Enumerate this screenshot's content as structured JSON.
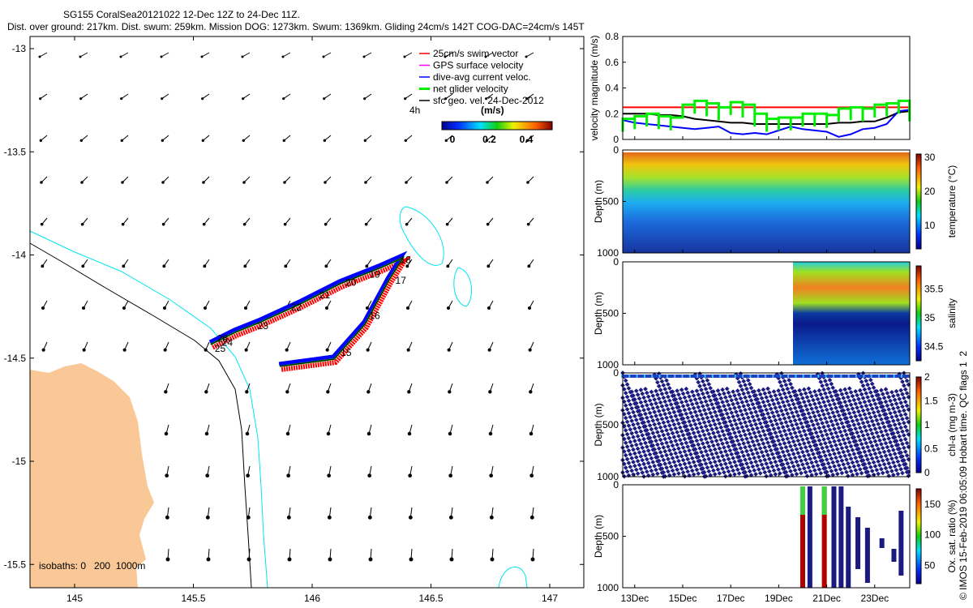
{
  "title": {
    "line1": "SG155 CoralSea20121022 12-Dec 12Z to 24-Dec 11Z.",
    "line2": "Dist. over ground: 217km. Dist. swum: 259km. Mission DOG: 1273km. Swum: 1369km. Gliding 24cm/s 142T COG-DAC=24cm/s 145T"
  },
  "colors": {
    "swim": "#ff0000",
    "gps": "#ff00ff",
    "dac": "#0000ff",
    "net": "#00ee00",
    "sfc": "#000000",
    "land": "#f9c896",
    "isobath200": "#000000",
    "isobath1000": "#00e5ee"
  },
  "chart_data": [
    {
      "type": "map",
      "xlim": [
        144.81,
        147.14
      ],
      "ylim": [
        -15.61,
        -12.94
      ],
      "xticks": [
        "145",
        "145.5",
        "146",
        "146.5",
        "147"
      ],
      "yticks": [
        "-13",
        "-13.5",
        "-14",
        "-14.5",
        "-15",
        "-15.5"
      ],
      "legend": {
        "placement": "top-right",
        "entries": [
          "25cm/s swim vector",
          "GPS surface velocity",
          "dive-avg current veloc.",
          "net glider velocity",
          "sfc geo. vel. 24-Dec-2012"
        ],
        "interval_label": "4h",
        "colorbar_label": "(m/s)",
        "colorbar_ticks": [
          "0",
          "0.2",
          "0.4"
        ]
      },
      "isobaths_label": "isobaths: 0   200  1000m",
      "track": [
        [
          145.864,
          -14.54
        ],
        [
          146.092,
          -14.505
        ],
        [
          146.222,
          -14.336
        ],
        [
          146.324,
          -14.12
        ],
        [
          146.382,
          -14.014
        ],
        [
          146.29,
          -14.061
        ],
        [
          146.119,
          -14.139
        ],
        [
          145.949,
          -14.238
        ],
        [
          145.778,
          -14.328
        ],
        [
          145.676,
          -14.375
        ],
        [
          145.573,
          -14.434
        ]
      ],
      "day_labels": [
        {
          "t": "15",
          "lon": 146.12,
          "lat": -14.49
        },
        {
          "t": "16",
          "lon": 146.24,
          "lat": -14.31
        },
        {
          "t": "17",
          "lon": 146.35,
          "lat": -14.14
        },
        {
          "t": "18",
          "lon": 146.37,
          "lat": -14.04
        },
        {
          "t": "19",
          "lon": 146.24,
          "lat": -14.11
        },
        {
          "t": "20",
          "lon": 146.14,
          "lat": -14.15
        },
        {
          "t": "21",
          "lon": 146.03,
          "lat": -14.21
        },
        {
          "t": "22",
          "lon": 145.91,
          "lat": -14.27
        },
        {
          "t": "23",
          "lon": 145.77,
          "lat": -14.36
        },
        {
          "t": "24",
          "lon": 145.62,
          "lat": -14.44
        },
        {
          "t": "25",
          "lon": 145.59,
          "lat": -14.47
        },
        {
          "t": "26",
          "lon": 145.6,
          "lat": -14.42
        }
      ]
    },
    {
      "type": "line",
      "ylabel": "velocity magnitude (m/s)",
      "ylim": [
        0,
        0.8
      ],
      "yticks": [
        "0",
        "0.2",
        "0.4",
        "0.6",
        "0.8"
      ],
      "x": [
        12.5,
        13,
        13.5,
        14,
        14.5,
        15,
        15.5,
        16,
        16.5,
        17,
        17.5,
        18,
        18.5,
        19,
        19.5,
        20,
        20.5,
        21,
        21.5,
        22,
        22.5,
        23,
        23.5,
        24,
        24.45
      ],
      "series": [
        {
          "color": "#ff0000",
          "values": [
            0.25,
            0.25,
            0.25,
            0.25,
            0.25,
            0.25,
            0.25,
            0.25,
            0.25,
            0.25,
            0.25,
            0.25,
            0.25,
            0.25,
            0.25,
            0.25,
            0.25,
            0.25,
            0.25,
            0.25,
            0.25,
            0.25,
            0.25,
            0.25,
            0.25
          ]
        },
        {
          "color": "#000000",
          "values": [
            0.2,
            0.2,
            0.2,
            0.19,
            0.19,
            0.18,
            0.16,
            0.15,
            0.14,
            0.13,
            0.13,
            0.12,
            0.12,
            0.12,
            0.12,
            0.12,
            0.12,
            0.12,
            0.13,
            0.13,
            0.14,
            0.14,
            0.17,
            0.21,
            0.22
          ]
        },
        {
          "color": "#0000ff",
          "values": [
            0.15,
            0.13,
            0.12,
            0.11,
            0.1,
            0.09,
            0.08,
            0.09,
            0.1,
            0.05,
            0.04,
            0.05,
            0.04,
            0.07,
            0.1,
            0.08,
            0.07,
            0.06,
            0.02,
            0.04,
            0.08,
            0.09,
            0.12,
            0.22,
            0.23
          ]
        },
        {
          "color": "#00ee00",
          "values": [
            0.16,
            0.18,
            0.2,
            0.18,
            0.17,
            0.27,
            0.3,
            0.28,
            0.25,
            0.29,
            0.27,
            0.2,
            0.16,
            0.17,
            0.17,
            0.2,
            0.2,
            0.19,
            0.24,
            0.25,
            0.24,
            0.27,
            0.28,
            0.3,
            0.24
          ]
        }
      ]
    },
    {
      "type": "heatmap",
      "ylabel": "Depth (m)",
      "yticks": [
        "0",
        "500",
        "1000"
      ],
      "colorbar_label": "temperature (°C)",
      "colorbar_ticks": [
        "10",
        "20",
        "30"
      ],
      "clim": [
        3,
        31
      ]
    },
    {
      "type": "heatmap",
      "ylabel": "Depth (m)",
      "yticks": [
        "0",
        "500",
        "1000"
      ],
      "colorbar_label": "salinity",
      "colorbar_ticks": [
        "34.5",
        "35",
        "35.5"
      ],
      "clim": [
        34.25,
        35.9
      ],
      "data_start_day": 20.2
    },
    {
      "type": "heatmap",
      "ylabel": "Depth (m)",
      "yticks": [
        "0",
        "500",
        "1000"
      ],
      "colorbar_label": "chl-a (mg m-3)",
      "colorbar_ticks": [
        "0",
        "0.5",
        "1",
        "1.5",
        "2"
      ],
      "clim": [
        0,
        2
      ]
    },
    {
      "type": "heatmap",
      "ylabel": "Depth (m)",
      "yticks": [
        "0",
        "500",
        "1000"
      ],
      "colorbar_label": "Ox. sat. ratio (%)",
      "colorbar_ticks": [
        "50",
        "100",
        "150"
      ],
      "clim": [
        20,
        175
      ]
    }
  ],
  "time_axis": {
    "ticks": [
      "13Dec",
      "15Dec",
      "17Dec",
      "19Dec",
      "21Dec",
      "23Dec"
    ],
    "days": [
      13,
      15,
      17,
      19,
      21,
      23
    ],
    "range": [
      12.5,
      24.46
    ]
  },
  "footer": "© IMOS 15-Feb-2019 06:05:09 Hobart time. QC flags 1  2"
}
